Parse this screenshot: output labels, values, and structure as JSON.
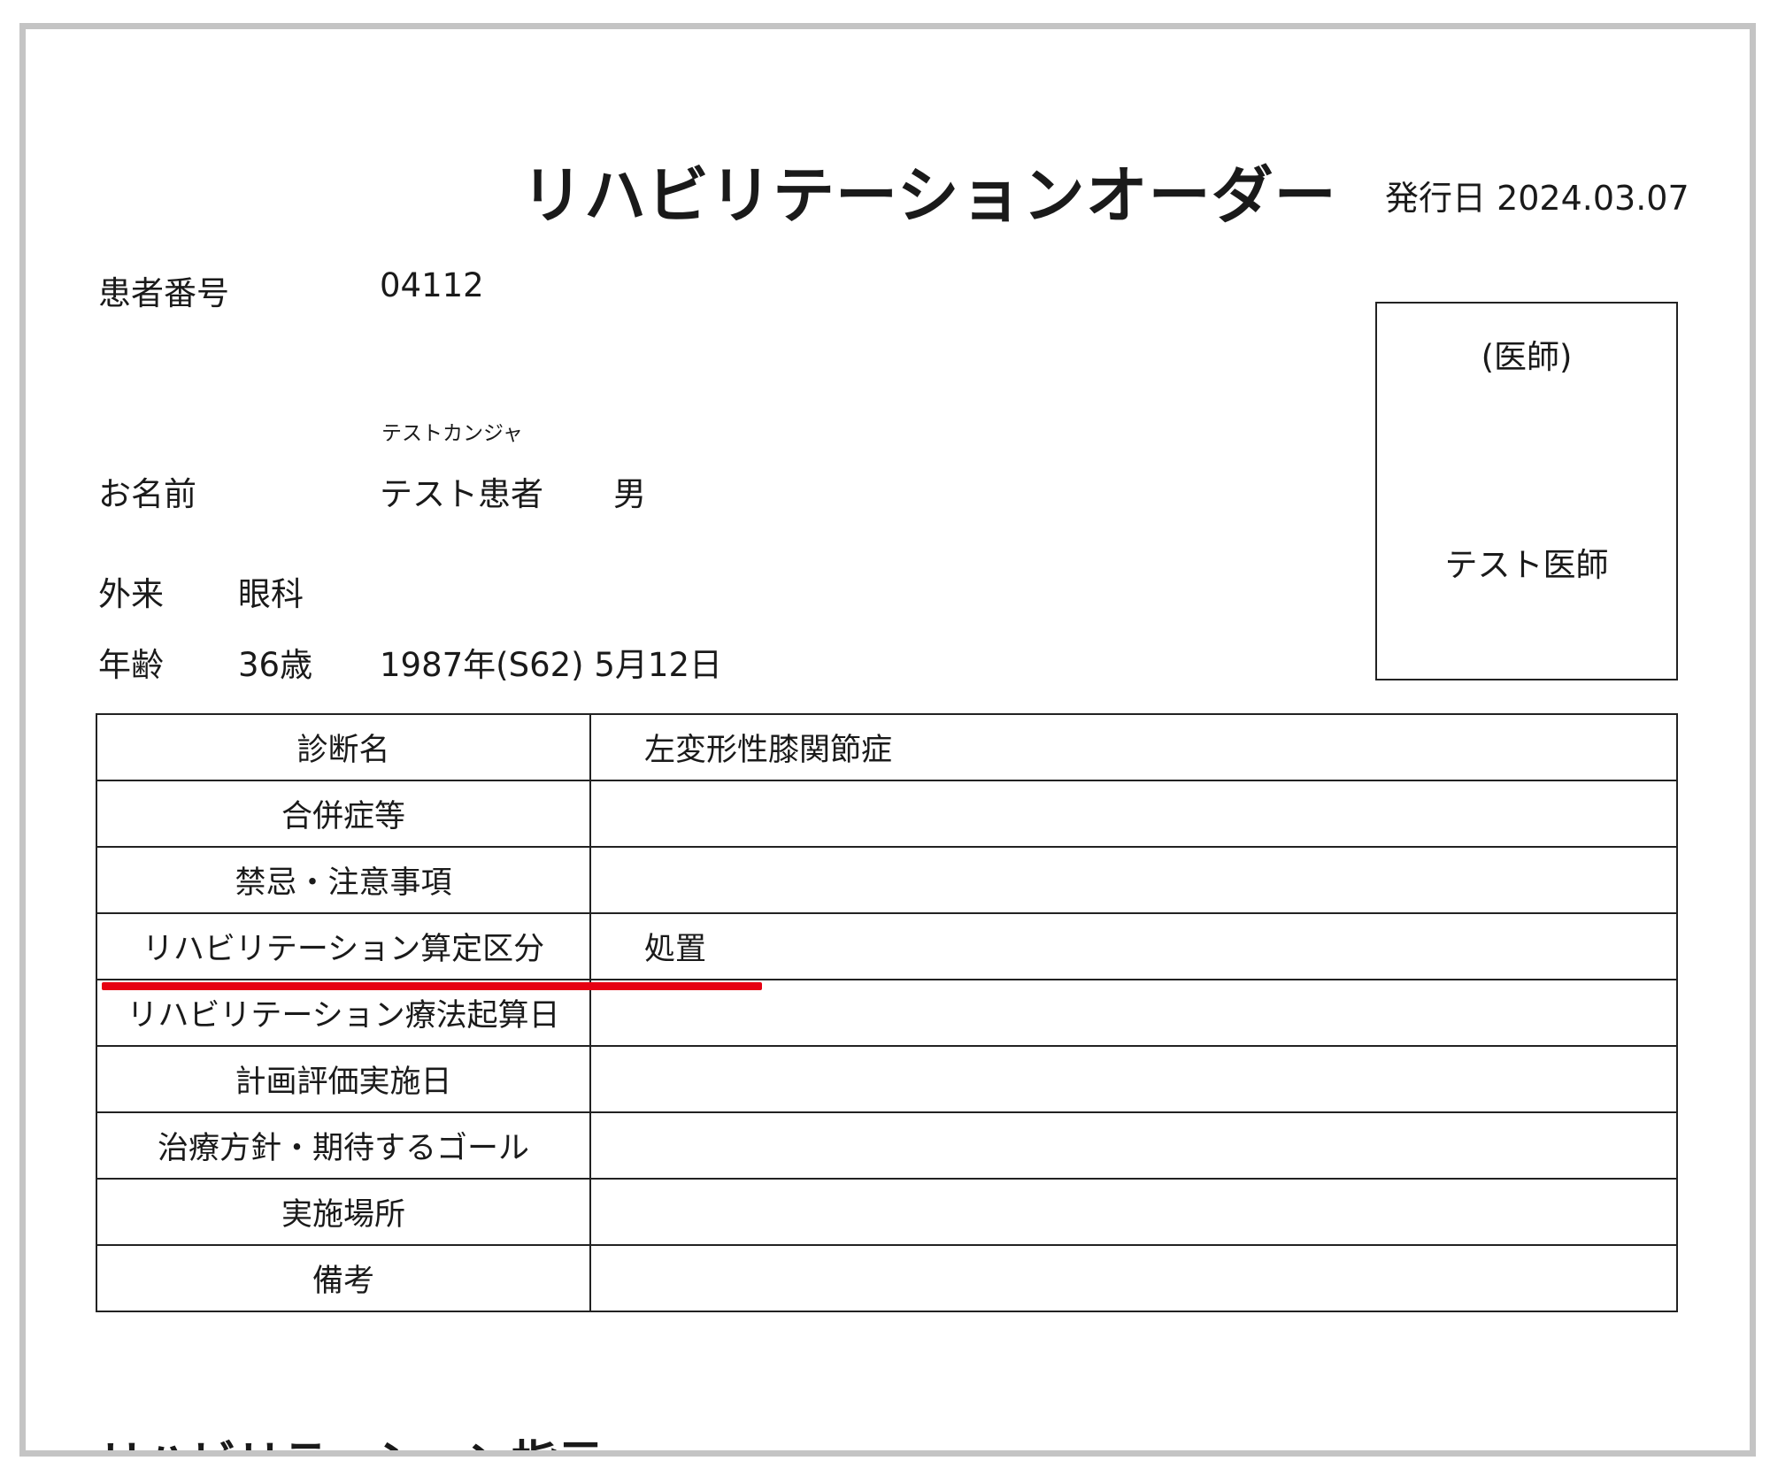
{
  "document": {
    "title": "リハビリテーションオーダー",
    "issue_date": "発行日 2024.03.07"
  },
  "patient": {
    "number_label": "患者番号",
    "number": "04112",
    "name_label": "お名前",
    "name_kana": "テストカンジャ",
    "name": "テスト患者",
    "sex": "男",
    "dept_type": "外来",
    "dept": "眼科",
    "age_label": "年齢",
    "age": "36歳",
    "birthdate": "1987年(S62) 5月12日"
  },
  "doctor": {
    "role": "(医師)",
    "name": "テスト医師"
  },
  "table": {
    "rows": [
      {
        "label": "診断名",
        "value": "左変形性膝関節症"
      },
      {
        "label": "合併症等",
        "value": ""
      },
      {
        "label": "禁忌・注意事項",
        "value": ""
      },
      {
        "label": "リハビリテーション算定区分",
        "value": "処置"
      },
      {
        "label": "リハビリテーション療法起算日",
        "value": ""
      },
      {
        "label": "計画評価実施日",
        "value": ""
      },
      {
        "label": "治療方針・期待するゴール",
        "value": ""
      },
      {
        "label": "実施場所",
        "value": ""
      },
      {
        "label": "備考",
        "value": ""
      }
    ]
  },
  "section_heading": "リハビリテーション指示",
  "highlight_color": "#e60012"
}
